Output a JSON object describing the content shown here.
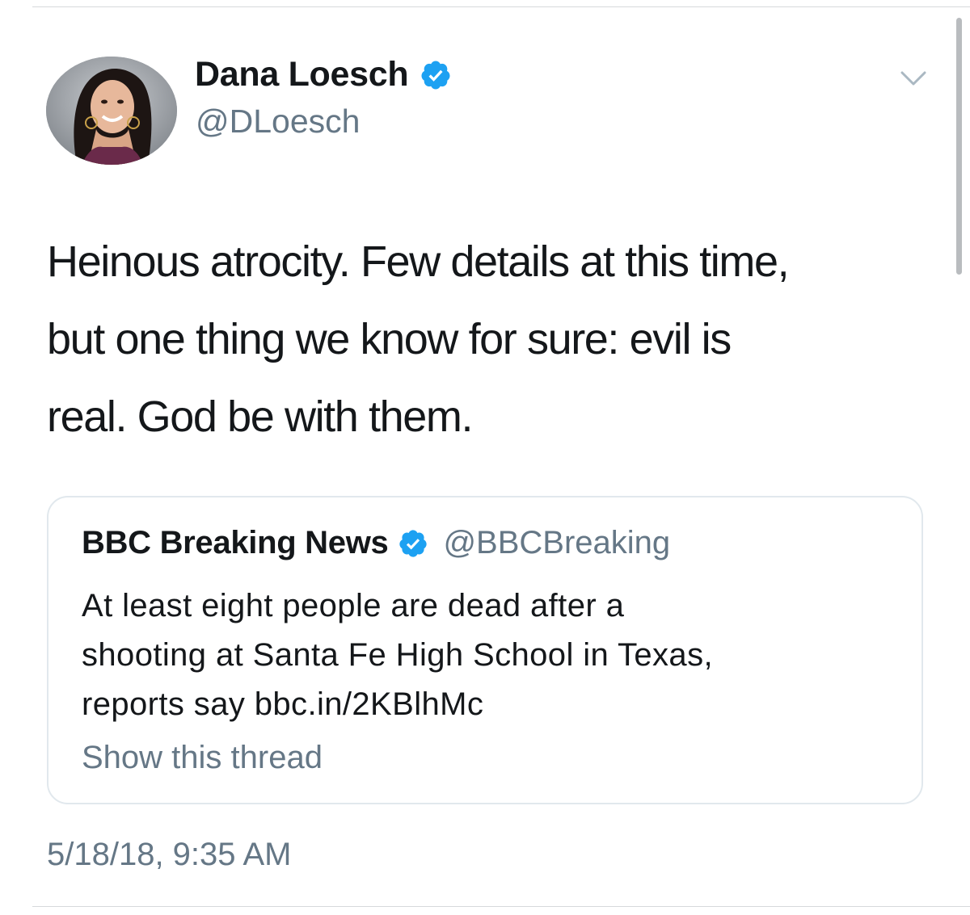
{
  "tweet": {
    "author": {
      "name": "Dana Loesch",
      "handle": "@DLoesch",
      "verified": true
    },
    "text_lines": [
      "Heinous atrocity. Few details at this time,",
      "but one thing we know for sure: evil is",
      "real. God be with them."
    ],
    "timestamp": "5/18/18, 9:35 AM",
    "menu_icon": "chevron-down-icon"
  },
  "quoted_tweet": {
    "author_name": "BBC Breaking News",
    "author_handle": "@BBCBreaking",
    "verified": true,
    "text_lines": [
      "At least eight people are dead after a",
      "shooting at Santa Fe High School in Texas,",
      "reports say bbc.in/2KBlhMc"
    ],
    "show_thread_label": "Show this thread"
  },
  "colors": {
    "text_primary": "#14171a",
    "text_secondary": "#657786",
    "verified_blue": "#1da1f2",
    "border": "#e1e8ed"
  }
}
